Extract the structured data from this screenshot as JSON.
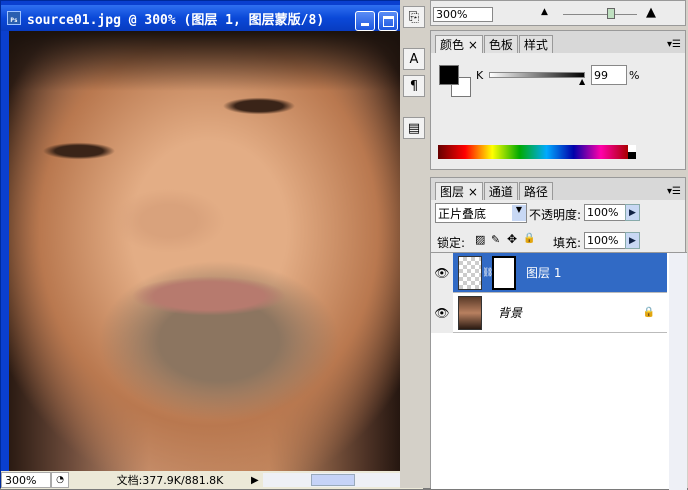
{
  "document": {
    "title": "source01.jpg @ 300% (图层 1, 图层蒙版/8)",
    "ps_icon": "Ps",
    "zoom": "300%",
    "doc_info": "文档:377.9K/881.8K"
  },
  "navigator": {
    "zoom": "300%",
    "zoom_fraction": 0.75
  },
  "color_panel": {
    "tabs": [
      "颜色",
      "色板",
      "样式"
    ],
    "channel": "K",
    "value": "99",
    "percent": "%",
    "fg_color": "#000000",
    "bg_color": "#ffffff"
  },
  "layers_panel": {
    "tabs": [
      "图层",
      "通道",
      "路径"
    ],
    "blend_mode": "正片叠底",
    "opacity_label": "不透明度:",
    "opacity": "100%",
    "lock_label": "锁定:",
    "fill_label": "填充:",
    "fill": "100%",
    "layers": [
      {
        "name": "图层 1",
        "selected": true
      },
      {
        "name": "背景",
        "locked": true
      }
    ]
  },
  "colors": {
    "titlebar": "#0a48d8",
    "selection": "#316ac5"
  }
}
